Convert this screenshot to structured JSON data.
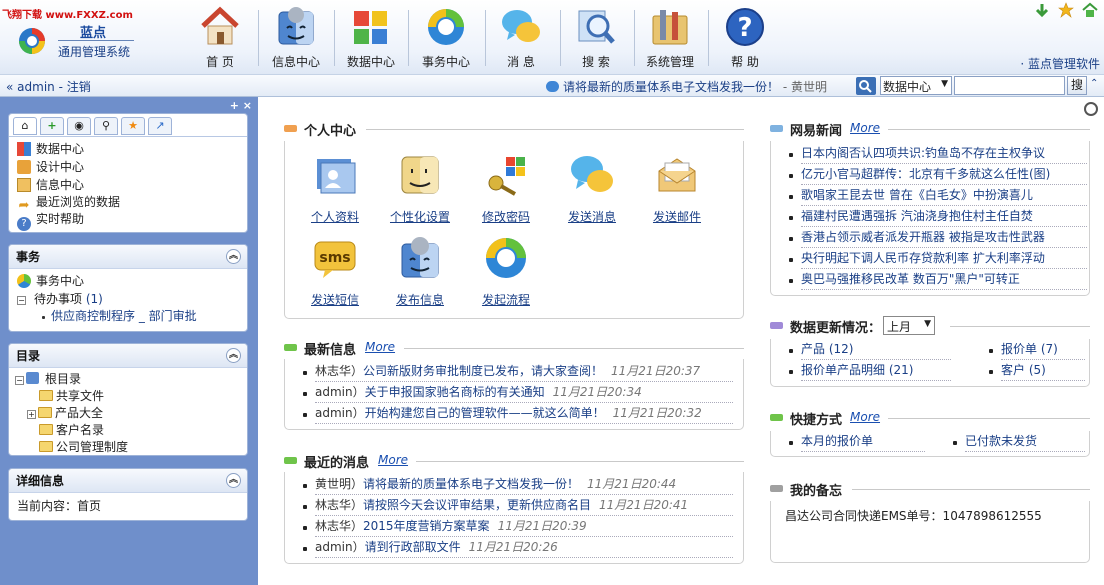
{
  "watermark": "飞翔下载 www.FXXZ.com",
  "brand": {
    "name": "蓝点",
    "subtitle": "通用管理系统"
  },
  "nav": [
    {
      "label": "首 页",
      "icon": "home-icon"
    },
    {
      "label": "信息中心",
      "icon": "finder-users-icon"
    },
    {
      "label": "数据中心",
      "icon": "data-blocks-icon"
    },
    {
      "label": "事务中心",
      "icon": "swirl-circle-icon"
    },
    {
      "label": "消 息",
      "icon": "chat-bubbles-icon"
    },
    {
      "label": "搜 索",
      "icon": "magnifier-icon"
    },
    {
      "label": "系统管理",
      "icon": "tools-folder-icon"
    },
    {
      "label": "帮 助",
      "icon": "help-icon"
    }
  ],
  "top_right_link": "· 蓝点管理软件",
  "toolbar": {
    "user": "« admin - 注销",
    "notice": "请将最新的质量体系电子文档发我一份！",
    "notice_author": " - 黄世明",
    "search_scope": "数据中心",
    "search_value": "",
    "search_button": "搜",
    "collapse": "»"
  },
  "sidebar": {
    "controls": "+ ×",
    "quick_tabs": [
      "home-icon",
      "add-icon",
      "eye-icon",
      "search-icon",
      "star-icon",
      "share-icon"
    ],
    "quick_items": [
      {
        "label": "数据中心",
        "icon": "data-blocks-icon"
      },
      {
        "label": "设计中心",
        "icon": "design-icon"
      },
      {
        "label": "信息中心",
        "icon": "info-doc-icon"
      },
      {
        "label": "最近浏览的数据",
        "icon": "arrow-icon"
      },
      {
        "label": "实时帮助",
        "icon": "help-icon"
      }
    ],
    "affairs": {
      "title": "事务",
      "center": "事务中心",
      "pending": "待办事项",
      "pending_count": "(1)",
      "pending_item": "供应商控制程序 _ 部门审批"
    },
    "directory": {
      "title": "目录",
      "root": "根目录",
      "folders": [
        "共享文件",
        "产品大全",
        "客户名录",
        "公司管理制度"
      ]
    },
    "detail": {
      "title": "详细信息",
      "current": "当前内容：首页"
    }
  },
  "personal_center": {
    "title": "个人中心",
    "tiles": [
      {
        "label": "个人资料",
        "icon": "profile-card-icon"
      },
      {
        "label": "个性化设置",
        "icon": "finder-face-icon"
      },
      {
        "label": "修改密码",
        "icon": "keys-icon"
      },
      {
        "label": "发送消息",
        "icon": "chat-bubbles-icon"
      },
      {
        "label": "发送邮件",
        "icon": "envelope-icon"
      },
      {
        "label": "发送短信",
        "icon": "sms-icon"
      },
      {
        "label": "发布信息",
        "icon": "finder-users-icon"
      },
      {
        "label": "发起流程",
        "icon": "swirl-circle-icon"
      }
    ]
  },
  "latest_info": {
    "title": "最新信息",
    "more": "More",
    "items": [
      {
        "who": "林志华）",
        "text": "公司新版财务审批制度已发布，请大家查阅！",
        "time": "11月21日20:37"
      },
      {
        "who": "admin）",
        "text": "关于申报国家驰名商标的有关通知",
        "time": "11月21日20:34"
      },
      {
        "who": "admin）",
        "text": "开始构建您自己的管理软件——就这么简单！",
        "time": "11月21日20:32"
      }
    ]
  },
  "recent_messages": {
    "title": "最近的消息",
    "more": "More",
    "items": [
      {
        "who": "黄世明）",
        "text": "请将最新的质量体系电子文档发我一份！",
        "time": "11月21日20:44"
      },
      {
        "who": "林志华）",
        "text": "请按照今天会议评审结果，更新供应商名目",
        "time": "11月21日20:41"
      },
      {
        "who": "林志华）",
        "text": "2015年度营销方案草案",
        "time": "11月21日20:39"
      },
      {
        "who": "admin）",
        "text": "请到行政部取文件",
        "time": "11月21日20:26"
      }
    ]
  },
  "news": {
    "title": "网易新闻",
    "more": "More",
    "items": [
      "日本内阁否认四项共识:钓鱼岛不存在主权争议",
      "亿元小官马超群传：北京有千多就这么任性(图)",
      "歌唱家王昆去世 曾在《白毛女》中扮演喜儿",
      "福建村民遭遇强拆 汽油浇身抱住村主任自焚",
      "香港占领示威者派发开瓶器 被指是攻击性武器",
      "央行明起下调人民币存贷款利率 扩大利率浮动",
      "奥巴马强推移民改革 数百万\"黑户\"可转正"
    ]
  },
  "data_updates": {
    "title": "数据更新情况：",
    "period": "上月",
    "items": [
      {
        "label": "产品",
        "count": "(12)"
      },
      {
        "label": "报价单",
        "count": "(7)"
      },
      {
        "label": "报价单产品明细",
        "count": "(21)"
      },
      {
        "label": "客户",
        "count": "(5)"
      }
    ]
  },
  "shortcuts": {
    "title": "快捷方式",
    "more": "More",
    "items": [
      "本月的报价单",
      "已付款未发货"
    ]
  },
  "memo": {
    "title": "我的备忘",
    "text": "昌达公司合同快递EMS单号：1047898612555"
  },
  "colors": {
    "sidebar": "#6f8fcb",
    "link": "#1a3f86",
    "orange_bar": "#f0a050",
    "green_bar": "#6fc44a",
    "blue_bar": "#7fb2e0",
    "purple_bar": "#a08ad8",
    "gray_bar": "#a0a0a0"
  }
}
